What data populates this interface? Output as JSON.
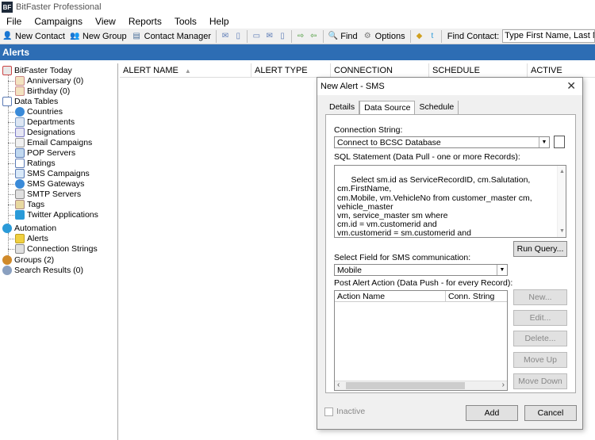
{
  "app": {
    "logo_text": "BF",
    "title": "BitFaster Professional"
  },
  "menu": [
    "File",
    "Campaigns",
    "View",
    "Reports",
    "Tools",
    "Help"
  ],
  "toolbar": {
    "new_contact": "New Contact",
    "new_group": "New Group",
    "contact_manager": "Contact Manager",
    "find": "Find",
    "options": "Options",
    "find_contact_label": "Find Contact:",
    "find_contact_placeholder": "Type First Name, Last Name or Em"
  },
  "section_title": "Alerts",
  "tree": {
    "bitfaster_today": "BitFaster Today",
    "anniversary": "Anniversary (0)",
    "birthday": "Birthday (0)",
    "data_tables": "Data Tables",
    "countries": "Countries",
    "departments": "Departments",
    "designations": "Designations",
    "email_campaigns": "Email Campaigns",
    "pop_servers": "POP Servers",
    "ratings": "Ratings",
    "sms_campaigns": "SMS Campaigns",
    "sms_gateways": "SMS Gateways",
    "smtp_servers": "SMTP Servers",
    "tags": "Tags",
    "twitter_applications": "Twitter Applications",
    "automation": "Automation",
    "alerts": "Alerts",
    "connection_strings": "Connection Strings",
    "groups": "Groups (2)",
    "search_results": "Search Results (0)"
  },
  "grid": {
    "columns": [
      "ALERT NAME",
      "ALERT TYPE",
      "CONNECTION",
      "SCHEDULE",
      "ACTIVE"
    ]
  },
  "dialog": {
    "title": "New Alert - SMS",
    "tabs": [
      "Details",
      "Data Source",
      "Schedule"
    ],
    "connection_string_label": "Connection String:",
    "connection_string_value": "Connect to BCSC Database",
    "sql_label": "SQL Statement (Data Pull - one or more Records):",
    "sql_text": "Select sm.id as ServiceRecordID, cm.Salutation, cm.FirstName,\ncm.Mobile, vm.VehicleNo from customer_master cm, vehicle_master\nvm, service_master sm where\ncm.id = vm.customerid and\nvm.customerid = sm.customerid and\nvm.id = sm.vehicleid and\nsm.servicedate = date() and sm.smssent = false",
    "run_query": "Run Query...",
    "select_field_label": "Select Field for SMS communication:",
    "select_field_value": "Mobile",
    "post_alert_label": "Post Alert Action (Data Push - for every Record):",
    "action_columns": [
      "Action Name",
      "Conn. String"
    ],
    "new_btn": "New...",
    "edit_btn": "Edit...",
    "delete_btn": "Delete...",
    "move_up_btn": "Move Up",
    "move_down_btn": "Move Down",
    "inactive_label": "Inactive",
    "add_btn": "Add",
    "cancel_btn": "Cancel"
  }
}
